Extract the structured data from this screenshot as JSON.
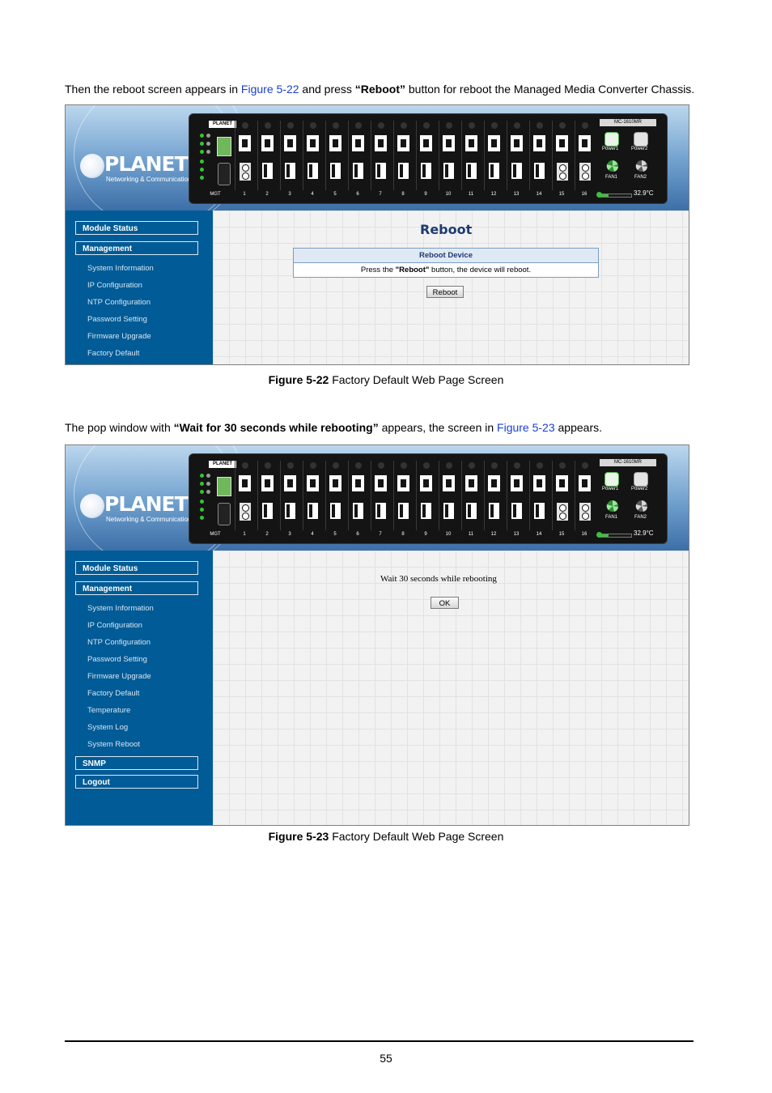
{
  "doc": {
    "para1": {
      "pre": "Then the reboot screen appears in ",
      "link": "Figure 5-22",
      "mid": " and press ",
      "bold": "“Reboot”",
      "post": " button for reboot the Managed Media Converter Chassis."
    },
    "caption1": {
      "label": "Figure 5-22",
      "text": " Factory Default Web Page Screen"
    },
    "para2": {
      "pre": "The pop window with ",
      "bold": "“Wait for 30 seconds while rebooting”",
      "mid": " appears, the screen in ",
      "link": "Figure 5-23",
      "post": " appears."
    },
    "caption2": {
      "label": "Figure 5-23",
      "text": " Factory Default Web Page Screen"
    },
    "page_number": "55"
  },
  "device": {
    "brand": "PLANET",
    "tagline": "Networking & Communication",
    "chassis_label": "PLANET",
    "model": "MC-1610MR",
    "mgt_label": "MGT",
    "ports": [
      "1",
      "2",
      "3",
      "4",
      "5",
      "6",
      "7",
      "8",
      "9",
      "10",
      "11",
      "12",
      "13",
      "14",
      "15",
      "16"
    ],
    "power1": "Power1",
    "power2": "Power2",
    "fan1": "FAN1",
    "fan2": "FAN2",
    "temperature": "32.9°C"
  },
  "screen1": {
    "menu_module_status": "Module Status",
    "menu_management": "Management",
    "submenu": [
      "System Information",
      "IP Configuration",
      "NTP Configuration",
      "Password Setting",
      "Firmware Upgrade",
      "Factory Default"
    ],
    "title": "Reboot",
    "table_header": "Reboot Device",
    "message_pre": "Press the ",
    "message_bold": "\"Reboot\"",
    "message_post": " button, the device will reboot.",
    "button": "Reboot"
  },
  "screen2": {
    "menu_module_status": "Module Status",
    "menu_management": "Management",
    "submenu": [
      "System Information",
      "IP Configuration",
      "NTP Configuration",
      "Password Setting",
      "Firmware Upgrade",
      "Factory Default",
      "Temperature",
      "System Log",
      "System Reboot"
    ],
    "menu_snmp": "SNMP",
    "menu_logout": "Logout",
    "wait_text": "Wait 30 seconds while rebooting",
    "ok_button": "OK"
  }
}
